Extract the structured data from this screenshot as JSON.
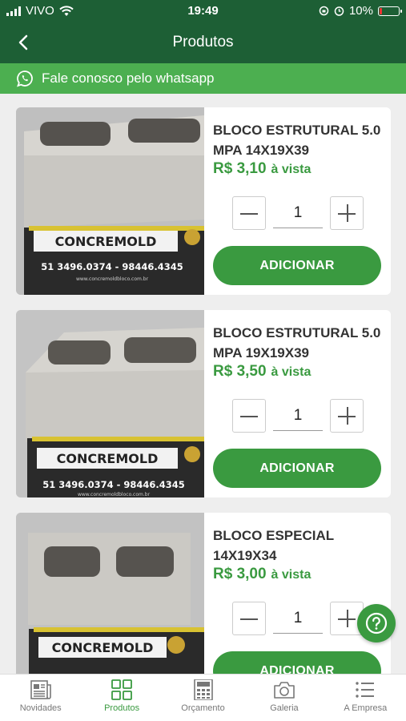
{
  "status": {
    "carrier": "VIVO",
    "time": "19:49",
    "battery": "10%"
  },
  "nav": {
    "title": "Produtos"
  },
  "whatsapp": {
    "label": "Fale conosco pelo whatsapp"
  },
  "products": [
    {
      "title": "BLOCO ESTRUTURAL 5.0 MPA 14X19X39",
      "price": "R$ 3,10",
      "payment": "à vista",
      "quantity": "1",
      "button": "ADICIONAR",
      "image_brand": "CONCREMOLD",
      "image_phone": "51 3496.0374 - 98446.4345",
      "image_url": "www.concremoldbloco.com.br"
    },
    {
      "title": "BLOCO ESTRUTURAL 5.0 MPA 19X19X39",
      "price": "R$ 3,50",
      "payment": "à vista",
      "quantity": "1",
      "button": "ADICIONAR",
      "image_brand": "CONCREMOLD",
      "image_phone": "51 3496.0374 - 98446.4345",
      "image_url": "www.concremoldbloco.com.br"
    },
    {
      "title": "BLOCO ESPECIAL 14X19X34",
      "price": "R$ 3,00",
      "payment": "à vista",
      "quantity": "1",
      "button": "ADICIONAR",
      "image_brand": "CONCREMOLD",
      "image_phone": "",
      "image_url": ""
    }
  ],
  "tabs": [
    {
      "label": "Novidades",
      "icon": "newspaper-icon",
      "active": false
    },
    {
      "label": "Produtos",
      "icon": "grid-icon",
      "active": true
    },
    {
      "label": "Orçamento",
      "icon": "calculator-icon",
      "active": false
    },
    {
      "label": "Galeria",
      "icon": "camera-icon",
      "active": false
    },
    {
      "label": "A Empresa",
      "icon": "list-icon",
      "active": false
    }
  ],
  "colors": {
    "header": "#1d5f35",
    "whatsapp_bar": "#4caf50",
    "accent": "#3a9a40"
  }
}
